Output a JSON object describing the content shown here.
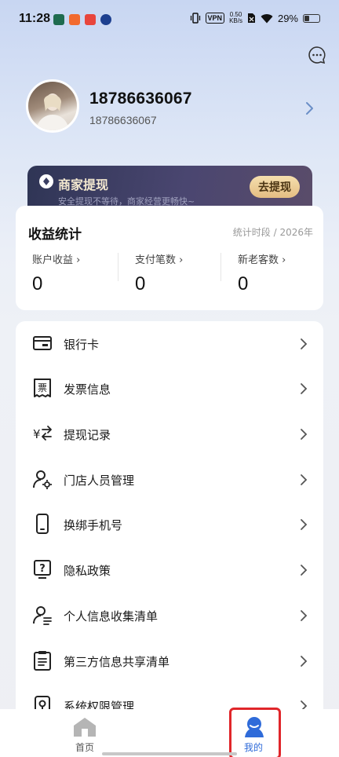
{
  "status_bar": {
    "time": "11:28",
    "vpn": "VPN",
    "speed_value": "0.50",
    "speed_unit": "KB/s",
    "battery": "29%"
  },
  "profile": {
    "phone": "18786636067",
    "account": "18786636067"
  },
  "banner": {
    "title": "商家提现",
    "subtitle": "安全提现不等待，商家经营更畅快~",
    "button": "去提现"
  },
  "stats": {
    "title": "收益统计",
    "period": "统计时段 / 2026年",
    "items": [
      {
        "label": "账户收益 ›",
        "value": "0"
      },
      {
        "label": "支付笔数 ›",
        "value": "0"
      },
      {
        "label": "新老客数 ›",
        "value": "0"
      }
    ]
  },
  "menu": {
    "items": [
      {
        "label": "银行卡",
        "icon": "bank-card-icon"
      },
      {
        "label": "发票信息",
        "icon": "invoice-icon"
      },
      {
        "label": "提现记录",
        "icon": "withdraw-record-icon"
      },
      {
        "label": "门店人员管理",
        "icon": "staff-settings-icon"
      },
      {
        "label": "换绑手机号",
        "icon": "mobile-phone-icon"
      },
      {
        "label": "隐私政策",
        "icon": "privacy-policy-icon"
      },
      {
        "label": "个人信息收集清单",
        "icon": "personal-info-icon"
      },
      {
        "label": "第三方信息共享清单",
        "icon": "clipboard-list-icon"
      },
      {
        "label": "系统权限管理",
        "icon": "system-permission-icon"
      }
    ]
  },
  "bottom_nav": {
    "home": "首页",
    "me": "我的",
    "active_color": "#2f6bd9"
  }
}
